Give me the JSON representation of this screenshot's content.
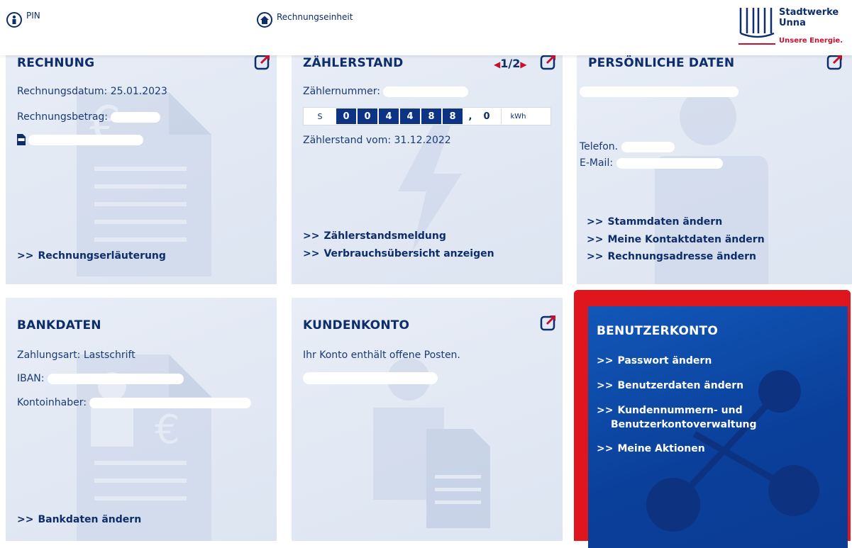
{
  "topbar": {
    "pin_label": "PIN",
    "pin_icon": "person-icon",
    "unit_label": "Rechnungseinheit",
    "unit_icon": "house-icon",
    "logo_name_line1": "Stadtwerke",
    "logo_name_line2": "Unna",
    "logo_tagline": "Unsere Energie."
  },
  "rechnung": {
    "title": "RECHNUNG",
    "date_label": "Rechnungsdatum: 25.01.2023",
    "amount_label": "Rechnungsbetrag:",
    "pdf_icon": "pdf-icon",
    "link1": "Rechnungserläuterung"
  },
  "zaehlerstand": {
    "title": "ZÄHLERSTAND",
    "pager": "1/2",
    "meter_no_label": "Zählernummer:",
    "meter_prefix": "S",
    "digits": [
      "0",
      "0",
      "4",
      "4",
      "8",
      "8"
    ],
    "separator": ",",
    "decimal": "0",
    "unit": "kWh",
    "reading_date": "Zählerstand vom: 31.12.2022",
    "link1": "Zählerstandsmeldung",
    "link2": "Verbrauchsübersicht anzeigen"
  },
  "persoenlich": {
    "title": "PERSÖNLICHE DATEN",
    "phone_label": "Telefon.",
    "email_label": "E-Mail:",
    "link1": "Stammdaten ändern",
    "link2": "Meine Kontaktdaten ändern",
    "link3": "Rechnungsadresse ändern"
  },
  "bankdaten": {
    "title": "BANKDATEN",
    "payment_label": "Zahlungsart: Lastschrift",
    "iban_label": "IBAN:",
    "owner_label": "Kontoinhaber:",
    "link1": "Bankdaten ändern"
  },
  "kundenkonto": {
    "title": "KUNDENKONTO",
    "text": "Ihr Konto enthält offene Posten."
  },
  "benutzerkonto": {
    "title": "BENUTZERKONTO",
    "link1": "Passwort ändern",
    "link2": "Benutzerdaten ändern",
    "link3a": "Kundennummern- und",
    "link3b": "Benutzerkontoverwaltung",
    "link4": "Meine Aktionen"
  },
  "colors": {
    "brand_blue": "#0d2d6b",
    "accent_red": "#c8102e",
    "highlight_red": "#e0161e",
    "active_card": "#0a3f9a"
  }
}
